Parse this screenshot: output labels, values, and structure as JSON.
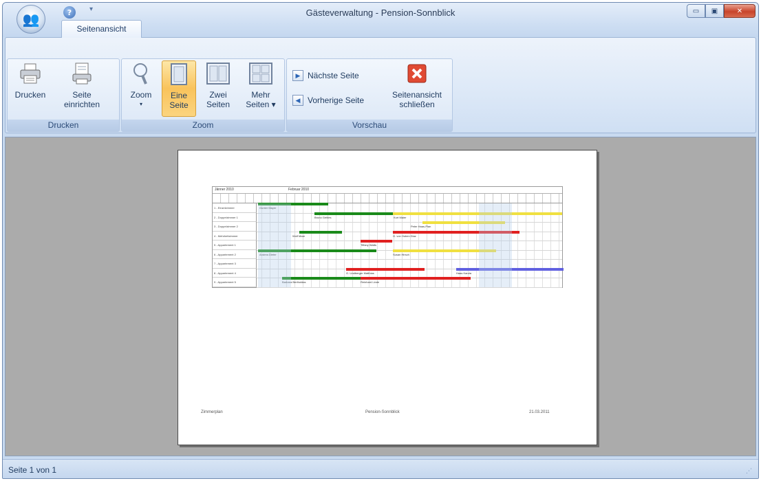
{
  "window": {
    "title": "Gästeverwaltung - Pension-Sonnblick",
    "qat_dropdown": "▾",
    "controls": {
      "minimize": "▭",
      "maximize": "▣",
      "close": "✕"
    }
  },
  "tabs": [
    {
      "label": "Seitenansicht",
      "active": true
    }
  ],
  "ribbon": {
    "groups": [
      {
        "label": "Drucken",
        "buttons": [
          {
            "label_line1": "Drucken",
            "label_line2": "",
            "icon": "printer-icon"
          },
          {
            "label_line1": "Seite",
            "label_line2": "einrichten",
            "icon": "page-setup-icon"
          }
        ]
      },
      {
        "label": "Zoom",
        "buttons": [
          {
            "label_line1": "Zoom",
            "label_line2": "▾",
            "icon": "magnifier-icon"
          },
          {
            "label_line1": "Eine",
            "label_line2": "Seite",
            "icon": "one-page-icon",
            "active": true
          },
          {
            "label_line1": "Zwei",
            "label_line2": "Seiten",
            "icon": "two-pages-icon"
          },
          {
            "label_line1": "Mehr",
            "label_line2": "Seiten ▾",
            "icon": "more-pages-icon"
          }
        ]
      },
      {
        "label": "Vorschau",
        "small_buttons": [
          {
            "label": "Nächste Seite",
            "icon": "next-page-icon"
          },
          {
            "label": "Vorherige Seite",
            "icon": "previous-page-icon"
          }
        ],
        "buttons": [
          {
            "label_line1": "Seitenansicht",
            "label_line2": "schließen",
            "icon": "close-preview-icon"
          }
        ]
      }
    ]
  },
  "page": {
    "months": [
      "Jänner 2010",
      "Februar 2010"
    ],
    "rooms": [
      "1 - Einzelzimmer",
      "2 - Doppelzimmer 1",
      "3 - Doppelzimmer 2",
      "4 - Mehrbettzimmer",
      "5 - Appartement 1",
      "6 - Appartement 2",
      "7 - Appartement 3",
      "8 - Appartement 4",
      "9 - Appartement 5"
    ],
    "bookings": [
      {
        "room": 0,
        "color": "#1a8a1a",
        "label": "Gunter Mayer"
      },
      {
        "room": 1,
        "color": "#1a8a1a",
        "label": "Bruno Gehles"
      },
      {
        "room": 1,
        "color": "#f0e040",
        "label": "Kurt Maier"
      },
      {
        "room": 2,
        "color": "#f0e040",
        "label": "Peter Haas-Plan"
      },
      {
        "room": 3,
        "color": "#1a8a1a",
        "label": "Wolf Mare"
      },
      {
        "room": 3,
        "color": "#e02020",
        "label": "G. von Huben Diaz"
      },
      {
        "room": 4,
        "color": "#e02020",
        "label": "Tiffany Watts"
      },
      {
        "room": 5,
        "color": "#1a8a1a",
        "label": "Andrea Dieter"
      },
      {
        "room": 5,
        "color": "#f0e040",
        "label": "Susan Hirsch"
      },
      {
        "room": 7,
        "color": "#e02020",
        "label": "G. Lindberger Matthias"
      },
      {
        "room": 7,
        "color": "#6060e0",
        "label": "Haas Karola"
      },
      {
        "room": 8,
        "color": "#1a8a1a",
        "label": "Barbara Bertholdas"
      },
      {
        "room": 8,
        "color": "#e02020",
        "label": "Reinhard Linde"
      }
    ],
    "footer": {
      "left": "Zimmerplan",
      "center": "Pension-Sonnblick",
      "right": "21.03.2011"
    }
  },
  "statusbar": {
    "text": "Seite 1 von 1"
  }
}
